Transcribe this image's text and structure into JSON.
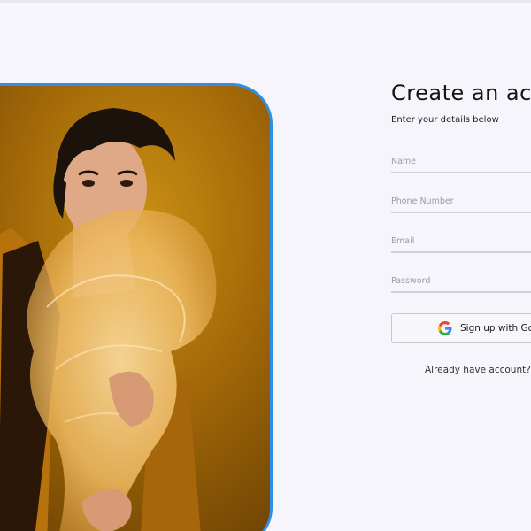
{
  "hero": {
    "image_description": "portrait-photo"
  },
  "form": {
    "title": "Create an account",
    "subtitle": "Enter your details below",
    "fields": {
      "name": {
        "placeholder": "Name"
      },
      "phone": {
        "placeholder": "Phone Number"
      },
      "email": {
        "placeholder": "Email"
      },
      "password": {
        "placeholder": "Password"
      }
    },
    "google_button": {
      "label": "Sign up with Google",
      "icon": "google-icon"
    },
    "login_link": "Already have account?"
  },
  "colors": {
    "background": "#f5f5fb",
    "image_border": "#2f8ee6",
    "input_underline": "#cfcfd6",
    "text_primary": "#141414"
  }
}
